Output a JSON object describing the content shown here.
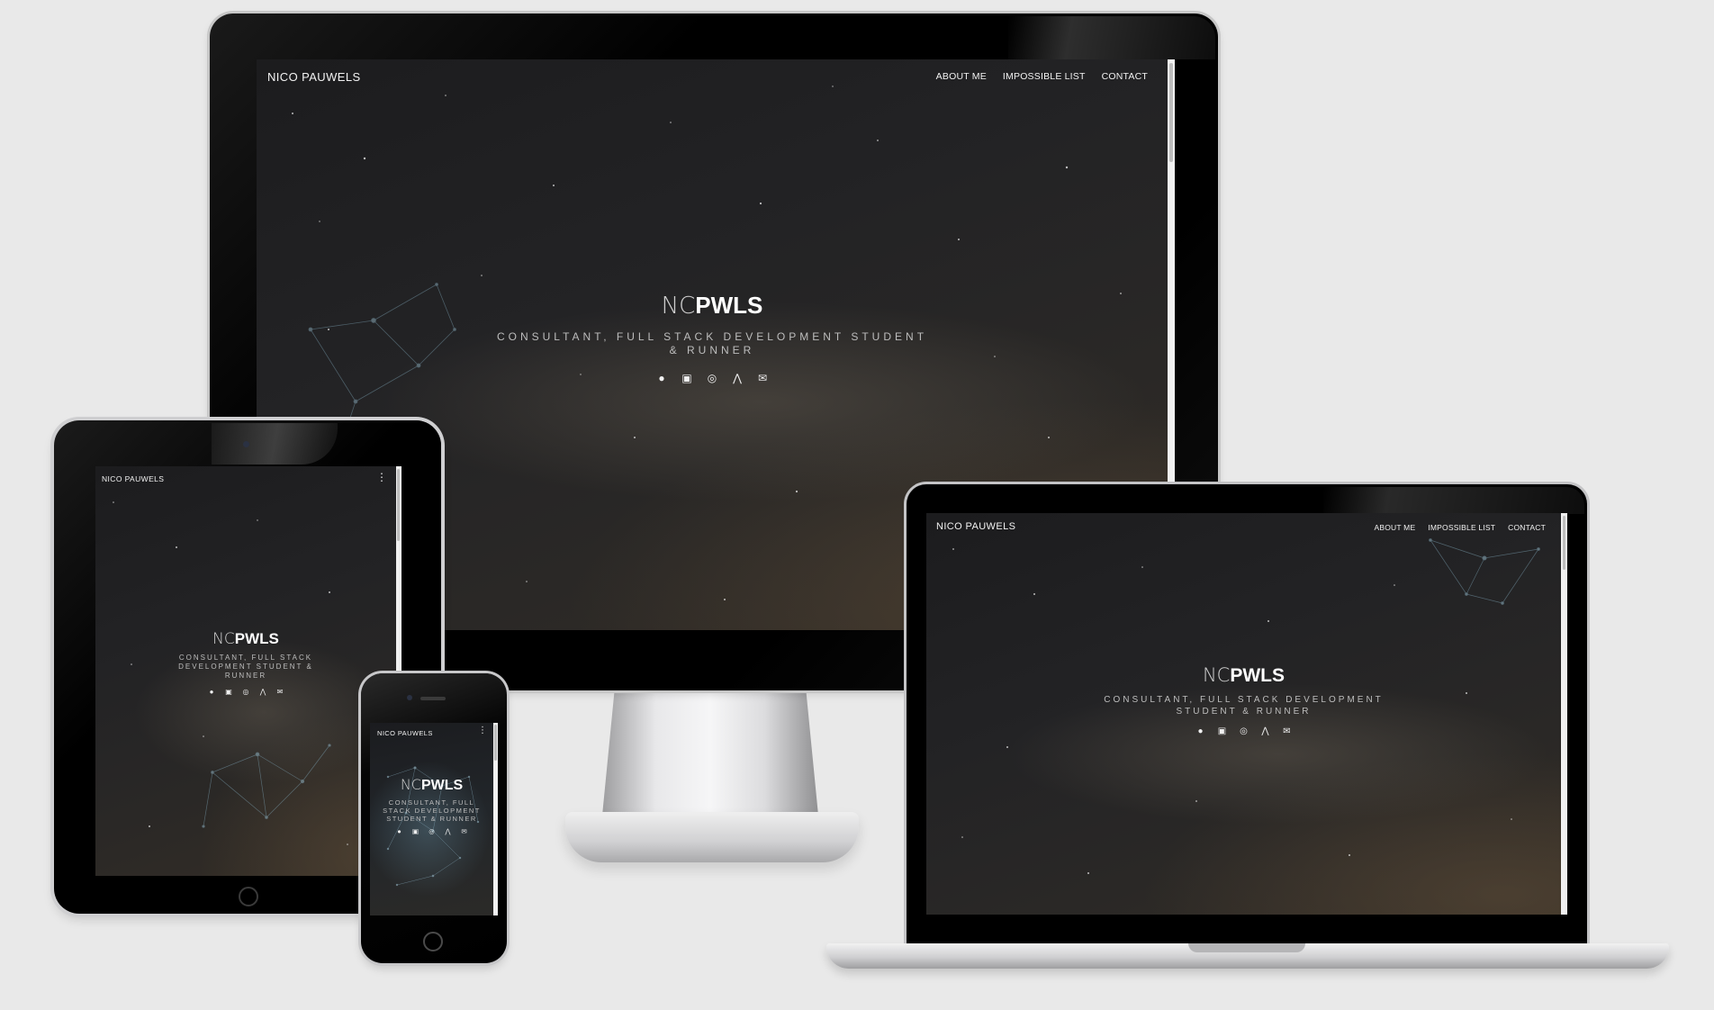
{
  "site": {
    "brand": "NICO PAUWELS",
    "nav": [
      "ABOUT ME",
      "IMPOSSIBLE LIST",
      "CONTACT"
    ],
    "logo_thin": "NC",
    "logo_bold": "PWLS",
    "tagline": "CONSULTANT, FULL STACK DEVELOPMENT STUDENT & RUNNER",
    "socials": [
      {
        "icon": "github-icon",
        "glyph": "●"
      },
      {
        "icon": "linkedin-icon",
        "glyph": "▣"
      },
      {
        "icon": "instagram-icon",
        "glyph": "◎"
      },
      {
        "icon": "strava-icon",
        "glyph": "⋀"
      },
      {
        "icon": "mail-icon",
        "glyph": "✉"
      }
    ],
    "menu_glyph": "⋮"
  },
  "colors": {
    "page_bg": "#e9e9e9",
    "device_black": "#000000",
    "silver": "#c9c9cb",
    "text": "#f2f2f2"
  }
}
